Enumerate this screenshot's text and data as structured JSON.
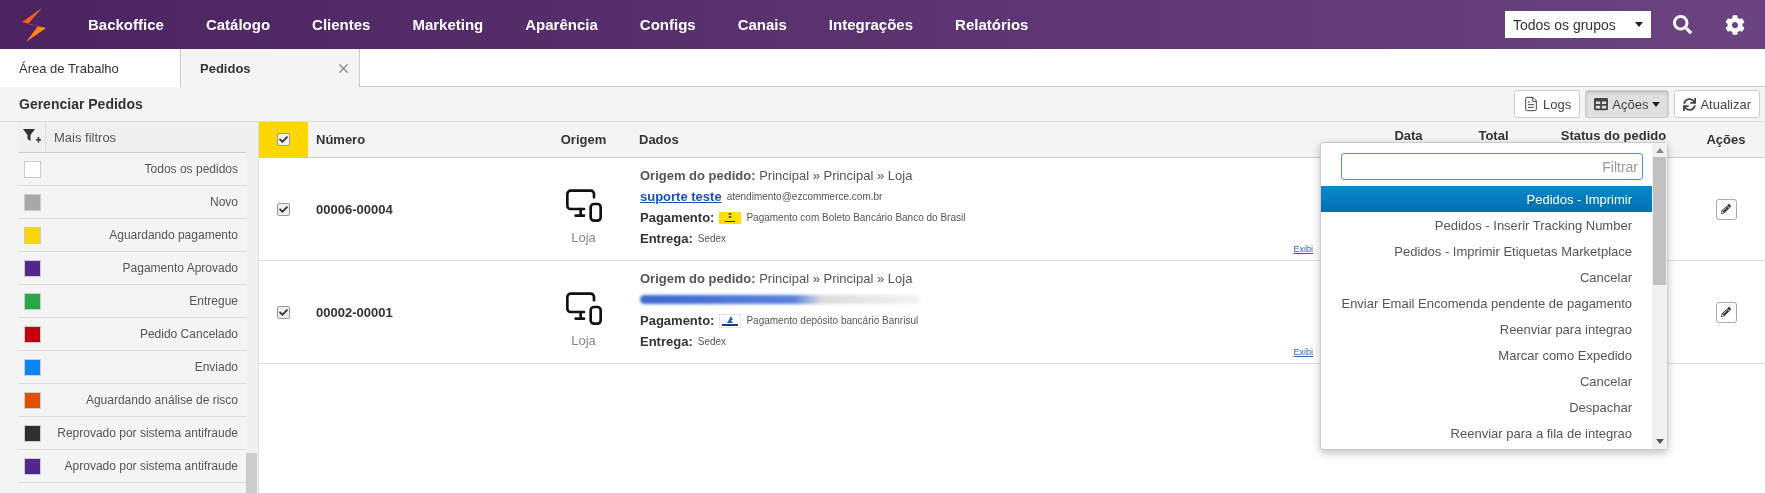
{
  "nav": {
    "items": [
      "Backoffice",
      "Catálogo",
      "Clientes",
      "Marketing",
      "Aparência",
      "Configs",
      "Canais",
      "Integrações",
      "Relatórios"
    ],
    "group_select": "Todos os grupos"
  },
  "tabs": [
    {
      "label": "Área de Trabalho",
      "selected": false,
      "closable": false
    },
    {
      "label": "Pedidos",
      "selected": true,
      "closable": true
    }
  ],
  "toolbar": {
    "title": "Gerenciar Pedidos",
    "buttons": [
      {
        "kind": "logs",
        "label": "Logs",
        "pressed": false,
        "caret": false
      },
      {
        "kind": "table",
        "label": "Ações",
        "pressed": true,
        "caret": true
      },
      {
        "kind": "refresh",
        "label": "Atualizar",
        "pressed": false,
        "caret": false
      }
    ]
  },
  "sidebar": {
    "header": "Mais filtros",
    "items": [
      {
        "label": "Todos os pedidos",
        "color": "#ffffff"
      },
      {
        "label": "Novo",
        "color": "#a8a8a8"
      },
      {
        "label": "Aguardando pagamento",
        "color": "#ffd700"
      },
      {
        "label": "Pagamento Aprovado",
        "color": "#52288f"
      },
      {
        "label": "Entregue",
        "color": "#28a745"
      },
      {
        "label": "Pedido Cancelado",
        "color": "#c00010"
      },
      {
        "label": "Enviado",
        "color": "#0a84ff"
      },
      {
        "label": "Aguardando análise de risco",
        "color": "#e05000"
      },
      {
        "label": "Reprovado por sistema antifraude",
        "color": "#303030"
      },
      {
        "label": "Aprovado por sistema antifraude",
        "color": "#52288f"
      }
    ]
  },
  "table": {
    "all_checked": true,
    "columns": [
      "Número",
      "Origem",
      "Dados",
      "Data",
      "Total",
      "Status do pedido",
      "Ações"
    ],
    "rows": [
      {
        "checked": true,
        "number": "00006-00004",
        "origin": "Loja",
        "order_origin": "**Origem do pedido:** Principal  »  Principal  »  Loja",
        "customer": {
          "kind": "contact",
          "name": "suporte teste",
          "email": "atendimento@ezcommerce.com.br"
        },
        "payment_label": "Pagamento:",
        "payment_logo": {
          "kind": "bb"
        },
        "payment": "Pagamento com Boleto Bancário Banco do Brasil",
        "delivery_label": "Entrega:",
        "delivery": "Sedex",
        "details_link": "Exibi"
      },
      {
        "checked": true,
        "number": "00002-00001",
        "origin": "Loja",
        "order_origin": "**Origem do pedido:** Principal  »  Principal  »  Loja",
        "customer": {
          "kind": "blurred"
        },
        "payment_label": "Pagamento:",
        "payment_logo": {
          "kind": "banrisul"
        },
        "payment": "Pagamento depósito bancário Banrisul",
        "delivery_label": "Entrega:",
        "delivery": "Sedex",
        "details_link": "Exibi"
      }
    ]
  },
  "actions_menu": {
    "placeholder": "Filtrar",
    "items": [
      {
        "label": "Pedidos - Imprimir",
        "selected": true
      },
      {
        "label": "Pedidos - Inserir Tracking Number",
        "selected": false
      },
      {
        "label": "Pedidos - Imprimir Etiquetas Marketplace",
        "selected": false
      },
      {
        "label": "Cancelar",
        "selected": false
      },
      {
        "label": "Enviar Email Encomenda pendente de pagamento",
        "selected": false
      },
      {
        "label": "Reenviar para integrao",
        "selected": false
      },
      {
        "label": "Marcar como Expedido",
        "selected": false
      },
      {
        "label": "Cancelar",
        "selected": false
      },
      {
        "label": "Despachar",
        "selected": false
      },
      {
        "label": "Reenviar para a fila de integrao",
        "selected": false
      }
    ]
  }
}
